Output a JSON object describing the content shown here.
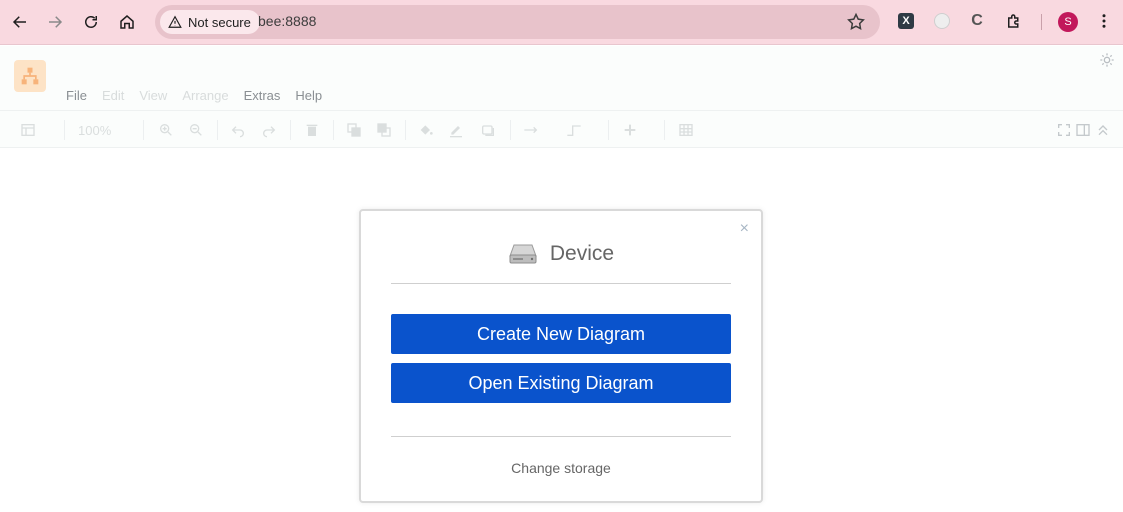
{
  "browser": {
    "security_label": "Not secure",
    "url": "bee:8888",
    "profile_initial": "S",
    "extensions": [
      "X",
      "C"
    ]
  },
  "app": {
    "menu": [
      {
        "label": "File",
        "enabled": true
      },
      {
        "label": "Edit",
        "enabled": false
      },
      {
        "label": "View",
        "enabled": false
      },
      {
        "label": "Arrange",
        "enabled": false
      },
      {
        "label": "Extras",
        "enabled": true
      },
      {
        "label": "Help",
        "enabled": true
      }
    ],
    "toolbar": {
      "zoom": "100%"
    }
  },
  "dialog": {
    "title": "Device",
    "create_label": "Create New Diagram",
    "open_label": "Open Existing Diagram",
    "change_storage_label": "Change storage",
    "close_glyph": "×",
    "icon": "hard-drive-icon"
  },
  "colors": {
    "chrome_bg": "#f9d9e0",
    "primary_button": "#0a53cc",
    "profile_avatar": "#c2185b"
  }
}
